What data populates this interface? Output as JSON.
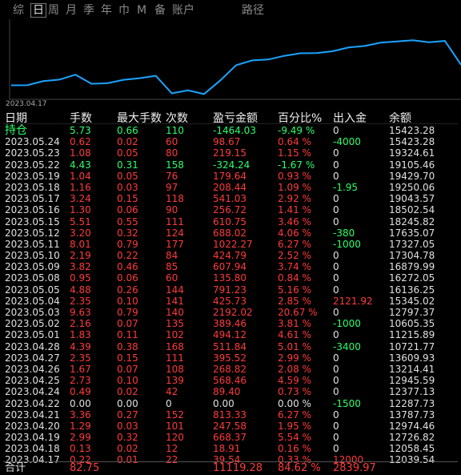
{
  "tabs": [
    "综",
    "日",
    "周",
    "月",
    "季",
    "年",
    "巾",
    "M",
    "备",
    "账户",
    "路径"
  ],
  "active_tab": "日",
  "chart": {
    "start_date_label": "2023.04.17",
    "line_color": "#1aa3ff",
    "values": [
      12039.54,
      12058.45,
      12726.82,
      12974.46,
      13787.73,
      12287.73,
      12377.13,
      12945.59,
      13214.41,
      13609.93,
      10721.77,
      11215.89,
      10605.35,
      12797.37,
      15345.02,
      16136.25,
      16272.05,
      16879.99,
      17304.78,
      17327.05,
      17635.07,
      18245.82,
      18502.54,
      19043.57,
      19250.06,
      19429.7,
      19105.46,
      19324.61,
      15423.28
    ]
  },
  "headers": [
    "日期",
    "手数",
    "最大手数",
    "次数",
    "盈亏金额",
    "百分比%",
    "出入金",
    "余额"
  ],
  "rows": [
    {
      "date": "持仓",
      "lots": "5.73",
      "max_lots": "0.66",
      "count": "110",
      "pnl": "-1464.03",
      "pct": "-9.49 %",
      "flow": "0",
      "balance": "15423.28",
      "c": "green",
      "flow_c": "white"
    },
    {
      "date": "2023.05.24",
      "lots": "0.62",
      "max_lots": "0.02",
      "count": "60",
      "pnl": "98.67",
      "pct": "0.64 %",
      "flow": "-4000",
      "balance": "15423.28",
      "c": "red",
      "flow_c": "green"
    },
    {
      "date": "2023.05.23",
      "lots": "1.08",
      "max_lots": "0.05",
      "count": "80",
      "pnl": "219.15",
      "pct": "1.15 %",
      "flow": "0",
      "balance": "19324.61",
      "c": "red",
      "flow_c": "white"
    },
    {
      "date": "2023.05.22",
      "lots": "4.43",
      "max_lots": "0.31",
      "count": "158",
      "pnl": "-324.24",
      "pct": "-1.67 %",
      "flow": "0",
      "balance": "19105.46",
      "c": "green",
      "flow_c": "white"
    },
    {
      "date": "2023.05.19",
      "lots": "1.04",
      "max_lots": "0.05",
      "count": "76",
      "pnl": "179.64",
      "pct": "0.93 %",
      "flow": "0",
      "balance": "19429.70",
      "c": "red",
      "flow_c": "white"
    },
    {
      "date": "2023.05.18",
      "lots": "1.16",
      "max_lots": "0.03",
      "count": "97",
      "pnl": "208.44",
      "pct": "1.09 %",
      "flow": "-1.95",
      "balance": "19250.06",
      "c": "red",
      "flow_c": "green"
    },
    {
      "date": "2023.05.17",
      "lots": "3.24",
      "max_lots": "0.15",
      "count": "118",
      "pnl": "541.03",
      "pct": "2.92 %",
      "flow": "0",
      "balance": "19043.57",
      "c": "red",
      "flow_c": "white"
    },
    {
      "date": "2023.05.16",
      "lots": "1.30",
      "max_lots": "0.06",
      "count": "90",
      "pnl": "256.72",
      "pct": "1.41 %",
      "flow": "0",
      "balance": "18502.54",
      "c": "red",
      "flow_c": "white"
    },
    {
      "date": "2023.05.15",
      "lots": "5.51",
      "max_lots": "0.55",
      "count": "111",
      "pnl": "610.75",
      "pct": "3.46 %",
      "flow": "0",
      "balance": "18245.82",
      "c": "red",
      "flow_c": "white"
    },
    {
      "date": "2023.05.12",
      "lots": "3.20",
      "max_lots": "0.32",
      "count": "124",
      "pnl": "688.02",
      "pct": "4.06 %",
      "flow": "-380",
      "balance": "17635.07",
      "c": "red",
      "flow_c": "green"
    },
    {
      "date": "2023.05.11",
      "lots": "8.01",
      "max_lots": "0.79",
      "count": "177",
      "pnl": "1022.27",
      "pct": "6.27 %",
      "flow": "-1000",
      "balance": "17327.05",
      "c": "red",
      "flow_c": "green"
    },
    {
      "date": "2023.05.10",
      "lots": "2.19",
      "max_lots": "0.22",
      "count": "84",
      "pnl": "424.79",
      "pct": "2.52 %",
      "flow": "0",
      "balance": "17304.78",
      "c": "red",
      "flow_c": "white"
    },
    {
      "date": "2023.05.09",
      "lots": "3.82",
      "max_lots": "0.46",
      "count": "85",
      "pnl": "607.94",
      "pct": "3.74 %",
      "flow": "0",
      "balance": "16879.99",
      "c": "red",
      "flow_c": "white"
    },
    {
      "date": "2023.05.08",
      "lots": "0.95",
      "max_lots": "0.06",
      "count": "60",
      "pnl": "135.80",
      "pct": "0.84 %",
      "flow": "0",
      "balance": "16272.05",
      "c": "red",
      "flow_c": "white"
    },
    {
      "date": "2023.05.05",
      "lots": "4.88",
      "max_lots": "0.26",
      "count": "144",
      "pnl": "791.23",
      "pct": "5.16 %",
      "flow": "0",
      "balance": "16136.25",
      "c": "red",
      "flow_c": "white"
    },
    {
      "date": "2023.05.04",
      "lots": "2.35",
      "max_lots": "0.10",
      "count": "141",
      "pnl": "425.73",
      "pct": "2.85 %",
      "flow": "2121.92",
      "balance": "15345.02",
      "c": "red",
      "flow_c": "red"
    },
    {
      "date": "2023.05.03",
      "lots": "9.63",
      "max_lots": "0.79",
      "count": "140",
      "pnl": "2192.02",
      "pct": "20.67 %",
      "flow": "0",
      "balance": "12797.37",
      "c": "red",
      "flow_c": "white"
    },
    {
      "date": "2023.05.02",
      "lots": "2.16",
      "max_lots": "0.07",
      "count": "135",
      "pnl": "389.46",
      "pct": "3.81 %",
      "flow": "-1000",
      "balance": "10605.35",
      "c": "red",
      "flow_c": "green"
    },
    {
      "date": "2023.05.01",
      "lots": "1.83",
      "max_lots": "0.11",
      "count": "102",
      "pnl": "494.12",
      "pct": "4.61 %",
      "flow": "0",
      "balance": "11215.89",
      "c": "red",
      "flow_c": "white"
    },
    {
      "date": "2023.04.28",
      "lots": "4.39",
      "max_lots": "0.38",
      "count": "168",
      "pnl": "511.84",
      "pct": "5.01 %",
      "flow": "-3400",
      "balance": "10721.77",
      "c": "red",
      "flow_c": "green"
    },
    {
      "date": "2023.04.27",
      "lots": "2.35",
      "max_lots": "0.15",
      "count": "111",
      "pnl": "395.52",
      "pct": "2.99 %",
      "flow": "0",
      "balance": "13609.93",
      "c": "red",
      "flow_c": "white"
    },
    {
      "date": "2023.04.26",
      "lots": "1.67",
      "max_lots": "0.07",
      "count": "108",
      "pnl": "268.82",
      "pct": "2.08 %",
      "flow": "0",
      "balance": "13214.41",
      "c": "red",
      "flow_c": "white"
    },
    {
      "date": "2023.04.25",
      "lots": "2.73",
      "max_lots": "0.10",
      "count": "139",
      "pnl": "568.46",
      "pct": "4.59 %",
      "flow": "0",
      "balance": "12945.59",
      "c": "red",
      "flow_c": "white"
    },
    {
      "date": "2023.04.24",
      "lots": "0.49",
      "max_lots": "0.02",
      "count": "42",
      "pnl": "89.40",
      "pct": "0.73 %",
      "flow": "0",
      "balance": "12377.13",
      "c": "red",
      "flow_c": "white"
    },
    {
      "date": "2023.04.22",
      "lots": "0.00",
      "max_lots": "0.00",
      "count": "0",
      "pnl": "0.00",
      "pct": "0.00 %",
      "flow": "-1500",
      "balance": "12287.73",
      "c": "white",
      "flow_c": "green"
    },
    {
      "date": "2023.04.21",
      "lots": "3.36",
      "max_lots": "0.27",
      "count": "152",
      "pnl": "813.33",
      "pct": "6.27 %",
      "flow": "0",
      "balance": "13787.73",
      "c": "red",
      "flow_c": "white"
    },
    {
      "date": "2023.04.20",
      "lots": "1.29",
      "max_lots": "0.03",
      "count": "101",
      "pnl": "247.58",
      "pct": "1.95 %",
      "flow": "0",
      "balance": "12974.46",
      "c": "red",
      "flow_c": "white"
    },
    {
      "date": "2023.04.19",
      "lots": "2.99",
      "max_lots": "0.32",
      "count": "120",
      "pnl": "668.37",
      "pct": "5.54 %",
      "flow": "0",
      "balance": "12726.82",
      "c": "red",
      "flow_c": "white"
    },
    {
      "date": "2023.04.18",
      "lots": "0.13",
      "max_lots": "0.02",
      "count": "12",
      "pnl": "18.91",
      "pct": "0.16 %",
      "flow": "0",
      "balance": "12058.45",
      "c": "red",
      "flow_c": "white"
    },
    {
      "date": "2023.04.17",
      "lots": "0.22",
      "max_lots": "0.01",
      "count": "22",
      "pnl": "39.54",
      "pct": "0.33 %",
      "flow": "12000",
      "balance": "12039.54",
      "c": "red",
      "flow_c": "red"
    }
  ],
  "total": {
    "label": "合计",
    "lots": "82.75",
    "pnl": "11119.28",
    "pct": "84.62 %",
    "flow": "2839.97"
  }
}
